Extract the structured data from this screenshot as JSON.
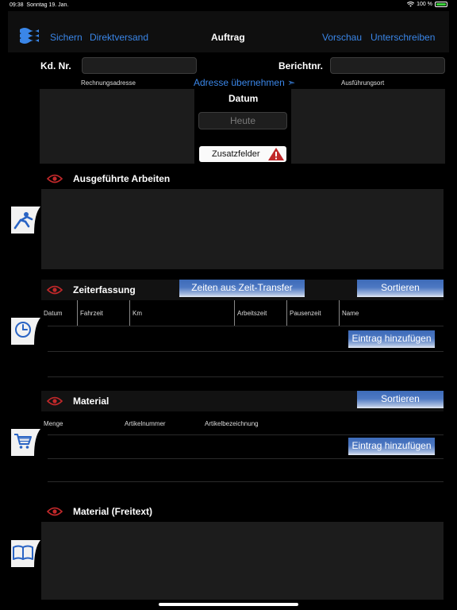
{
  "status": {
    "time": "09:38",
    "date": "Sonntag 19. Jan.",
    "battery": "100 %"
  },
  "nav": {
    "save": "Sichern",
    "direct_send": "Direktversand",
    "title": "Auftrag",
    "preview": "Vorschau",
    "sign": "Unterschreiben"
  },
  "header": {
    "customer_no_label": "Kd. Nr.",
    "customer_no_value": "",
    "report_no_label": "Berichtnr.",
    "report_no_value": "",
    "billing_address_label": "Rechnungsadresse",
    "copy_address": "Adresse übernehmen ➣",
    "site_label": "Ausführungsort",
    "date_label": "Datum",
    "date_placeholder": "Heute",
    "extra_fields": "Zusatzfelder"
  },
  "work": {
    "title": "Ausgeführte Arbeiten",
    "text": ""
  },
  "time": {
    "title": "Zeiterfassung",
    "transfer_button": "Zeiten aus Zeit-Transfer",
    "sort_button": "Sortieren",
    "columns": [
      "Datum",
      "Fahrzeit",
      "Km",
      "Arbeitszeit",
      "Pausenzeit",
      "Name"
    ],
    "add_button": "Eintrag hinzufügen"
  },
  "material": {
    "title": "Material",
    "sort_button": "Sortieren",
    "columns": [
      "Menge",
      "Artikelnummer",
      "Artikelbezeichnung"
    ],
    "add_button": "Eintrag hinzufügen"
  },
  "material_free": {
    "title": "Material (Freitext)",
    "text": ""
  },
  "icons": {
    "logo": "waves-logo-icon",
    "warning": "warning-icon",
    "eye": "eye-icon",
    "work": "worker-icon",
    "clock": "clock-icon",
    "cart": "cart-icon",
    "book": "book-icon"
  },
  "colors": {
    "accent": "#3a86e8",
    "eye": "#c0282a",
    "warning": "#c0282a"
  }
}
